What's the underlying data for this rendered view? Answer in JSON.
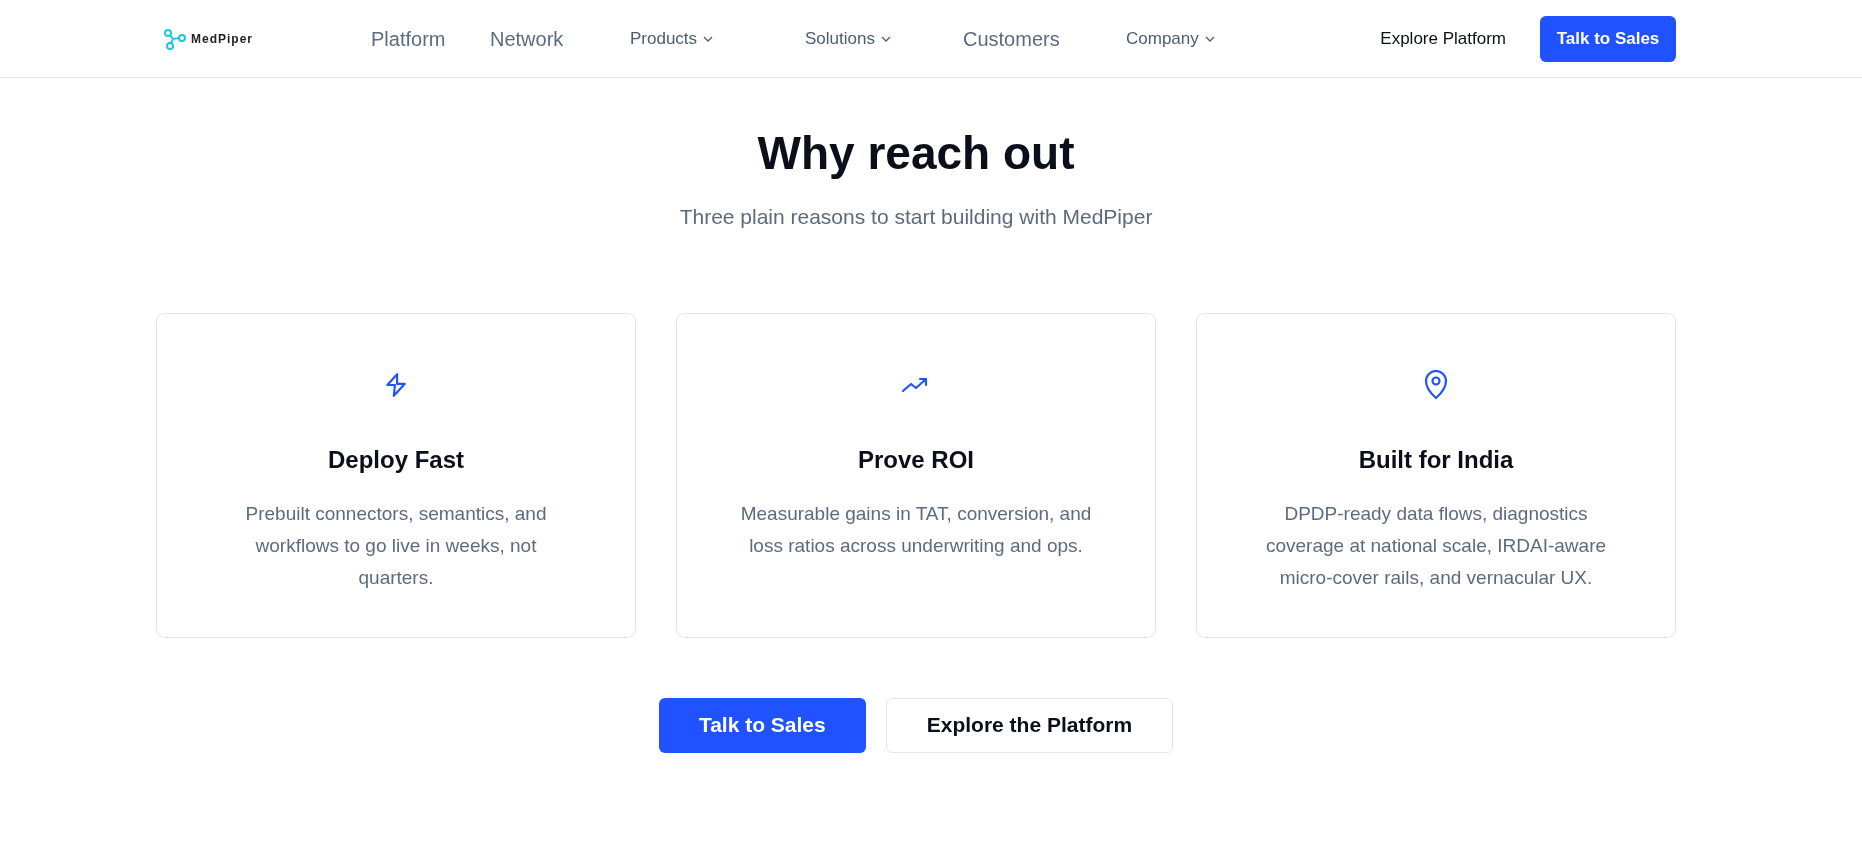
{
  "header": {
    "logo": "MedPiper",
    "nav": [
      {
        "label": "Platform",
        "kind": "link"
      },
      {
        "label": "Network",
        "kind": "link"
      },
      {
        "label": "Products",
        "kind": "dropdown"
      },
      {
        "label": "Solutions",
        "kind": "dropdown"
      },
      {
        "label": "Customers",
        "kind": "link"
      },
      {
        "label": "Company",
        "kind": "dropdown"
      }
    ],
    "explore_link": "Explore Platform",
    "cta": "Talk to Sales"
  },
  "section": {
    "title": "Why reach out",
    "subtitle": "Three plain reasons to start building with MedPiper",
    "cards": [
      {
        "title": "Deploy Fast",
        "text": "Prebuilt connectors, semantics, and workflows to go live in weeks, not quarters."
      },
      {
        "title": "Prove ROI",
        "text": "Measurable gains in TAT, conversion, and loss ratios across underwriting and ops."
      },
      {
        "title": "Built for India",
        "text": "DPDP-ready data flows, diagnostics coverage at national scale, IRDAI-aware micro-cover rails, and vernacular UX."
      }
    ],
    "buttons": [
      {
        "label": "Talk to Sales",
        "kind": "primary"
      },
      {
        "label": "Explore the Platform",
        "kind": "secondary"
      }
    ]
  }
}
